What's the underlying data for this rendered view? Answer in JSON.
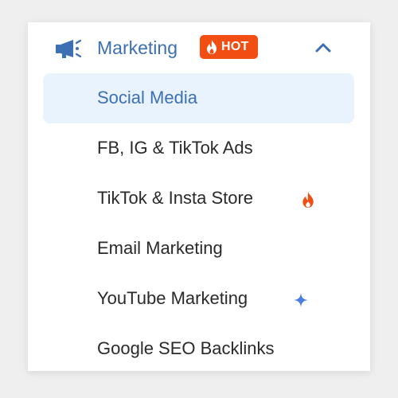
{
  "menu": {
    "header": {
      "icon": "megaphone-icon",
      "label": "Marketing",
      "badge": {
        "label": "HOT",
        "icon": "fire-icon",
        "color": "#f24d12"
      },
      "toggle_icon": "chevron-up-icon",
      "accent_color": "#3d6fb3"
    },
    "items": [
      {
        "label": "Social Media",
        "active": true
      },
      {
        "label": "FB, IG & TikTok Ads"
      },
      {
        "label": "TikTok & Insta Store",
        "trailing_icon": "fire-icon"
      },
      {
        "label": "Email Marketing"
      },
      {
        "label": "YouTube Marketing",
        "trailing_icon": "sparkle-icon"
      },
      {
        "label": "Google SEO Backlinks"
      }
    ],
    "active_background": "#e8f3fd"
  }
}
